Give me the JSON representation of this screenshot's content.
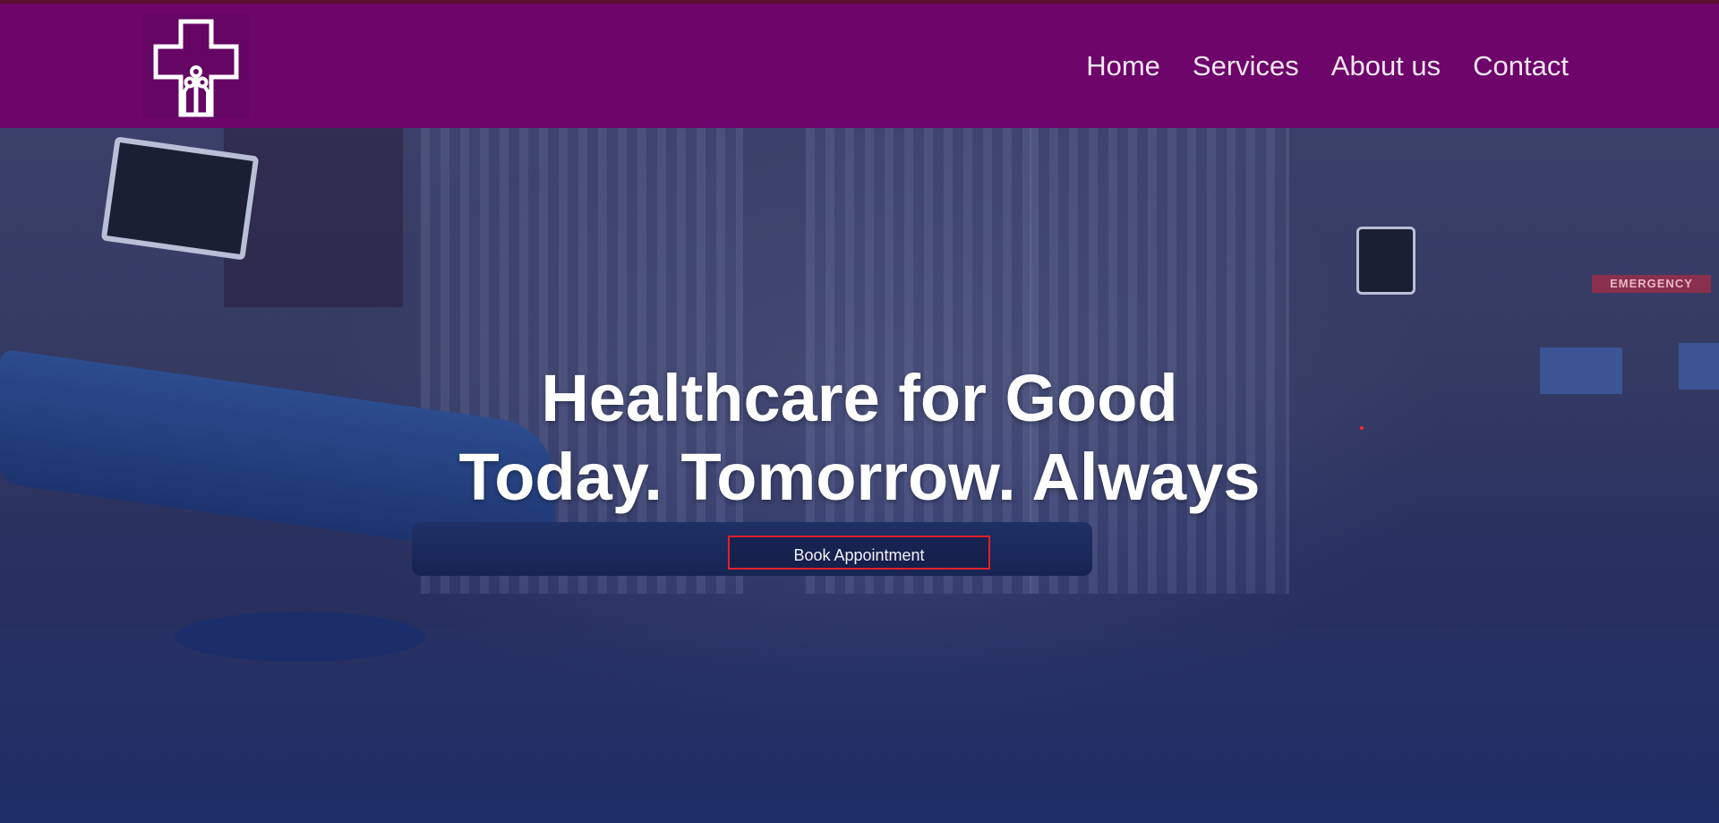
{
  "brand": {
    "logo_icon": "medical-cross-circuit-icon"
  },
  "nav": {
    "items": [
      {
        "label": "Home"
      },
      {
        "label": "Services"
      },
      {
        "label": "About us"
      },
      {
        "label": "Contact"
      }
    ]
  },
  "hero": {
    "headline_line1": "Healthcare for Good",
    "headline_line2": "Today. Tomorrow. Always",
    "cta_label": "Book Appointment",
    "sign_text": "EMERGENCY"
  },
  "colors": {
    "header_bg": "#6d056b",
    "nav_text": "#f4e7f3",
    "cta_border": "#e01f2a",
    "hero_overlay": "#2a3160"
  }
}
